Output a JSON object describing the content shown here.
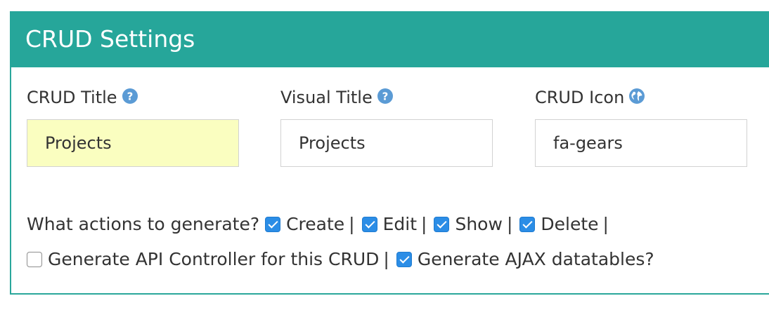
{
  "panel": {
    "title": "CRUD Settings"
  },
  "fields": {
    "crud_title": {
      "label": "CRUD Title",
      "value": "Projects",
      "icon": "question-circle-icon"
    },
    "visual_title": {
      "label": "Visual Title",
      "value": "Projects",
      "icon": "question-circle-icon"
    },
    "crud_icon": {
      "label": "CRUD Icon",
      "value": "fa-gears",
      "icon": "globe-icon"
    }
  },
  "actions": {
    "prompt": "What actions to generate?",
    "separator": "|",
    "create": {
      "label": "Create",
      "checked": true
    },
    "edit": {
      "label": "Edit",
      "checked": true
    },
    "show": {
      "label": "Show",
      "checked": true
    },
    "delete": {
      "label": "Delete",
      "checked": true
    }
  },
  "options": {
    "api_controller": {
      "label": "Generate API Controller for this CRUD",
      "checked": false
    },
    "ajax_datatables": {
      "label": "Generate AJAX datatables?",
      "checked": true
    }
  },
  "colors": {
    "header": "#26a69a",
    "panel_border": "#2aa79b",
    "checkbox_checked": "#2b8de6",
    "info_icon": "#5b9bd5",
    "autofill_background": "#fafec0"
  }
}
